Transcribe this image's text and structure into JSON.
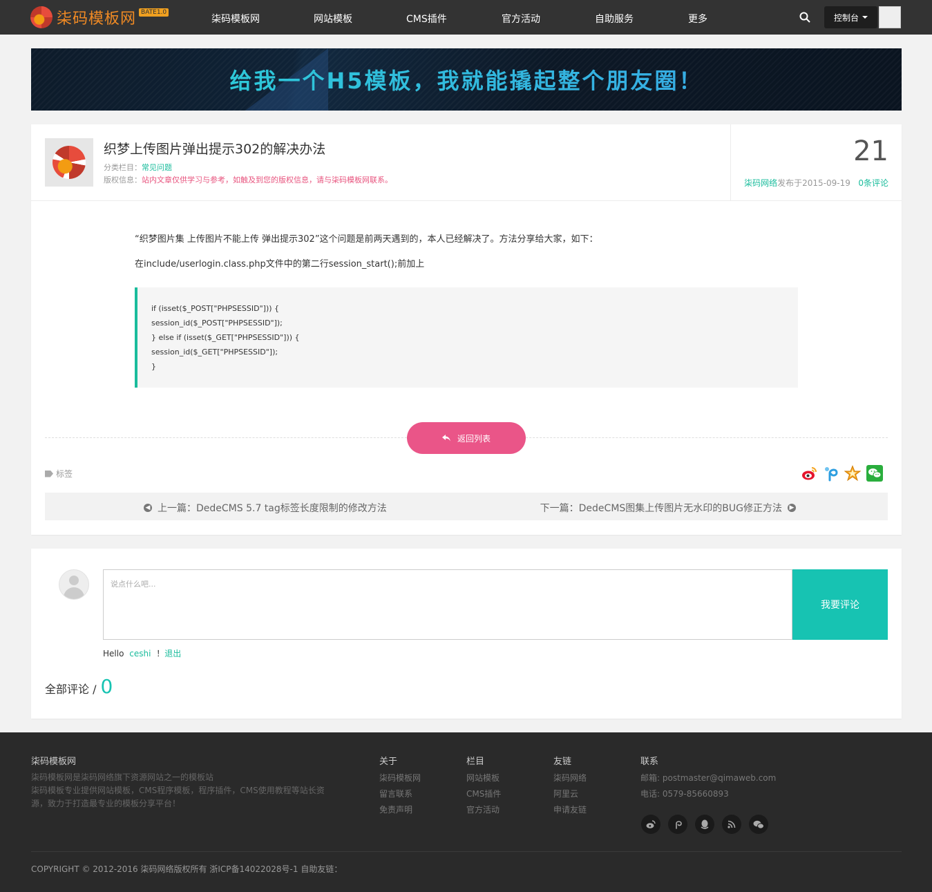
{
  "header": {
    "logo_text": "柒码模板网",
    "logo_badge": "BATE1.0",
    "nav": [
      "柒码模板网",
      "网站模板",
      "CMS插件",
      "官方活动",
      "自助服务",
      "更多"
    ],
    "console_label": "控制台"
  },
  "banner": {
    "text": "给我一个H5模板，我就能撬起整个朋友圈！"
  },
  "article": {
    "title": "织梦上传图片弹出提示302的解决办法",
    "category_label": "分类栏目：",
    "category": "常见问题",
    "copyright_label": "版权信息：",
    "copyright": "站内文章仅供学习与参考，如触及到您的版权信息，请与柒码模板网联系。",
    "day": "21",
    "author": "柒码网络",
    "published": "发布于2015-09-19",
    "comments_link": "0条评论",
    "p1": "“织梦图片集 上传图片不能上传 弹出提示302”这个问题是前两天遇到的，本人已经解决了。方法分享给大家，如下：",
    "p2": "在include/userlogin.class.php文件中的第二行session_start();前加上",
    "code": [
      "if (isset($_POST[\"PHPSESSID\"])) {",
      "session_id($_POST[\"PHPSESSID\"]);",
      "} else if (isset($_GET[\"PHPSESSID\"])) {",
      "session_id($_GET[\"PHPSESSID\"]);",
      "}"
    ],
    "back_label": "返回列表",
    "tags_label": "标签",
    "prev": "上一篇：DedeCMS 5.7 tag标签长度限制的修改方法",
    "next": "下一篇：DedeCMS图集上传图片无水印的BUG修正方法"
  },
  "comment": {
    "placeholder": "说点什么吧...",
    "submit_label": "我要评论",
    "hello_prefix": "Hello",
    "username": "ceshi",
    "logout_sep": "！",
    "logout": "退出",
    "all_label": "全部评论 /",
    "count": "0"
  },
  "footer": {
    "site_title": "柒码模板网",
    "site_desc1": "柒码模板网是柒码网络旗下资源网站之一的模板站",
    "site_desc2": "柒码模板专业提供网站模板，CMS程序模板，程序插件，CMS使用教程等站长资",
    "site_desc3": "源，致力于打造最专业的模板分享平台！",
    "col_about": {
      "title": "关于",
      "links": [
        "柒码模板网",
        "留言联系",
        "免责声明"
      ]
    },
    "col_column": {
      "title": "栏目",
      "links": [
        "网站模板",
        "CMS插件",
        "官方活动"
      ]
    },
    "col_friends": {
      "title": "友链",
      "links": [
        "柒码网络",
        "阿里云",
        "申请友链"
      ]
    },
    "col_contact": {
      "title": "联系",
      "email": "邮箱: postmaster@qimaweb.com",
      "phone": "电话: 0579-85660893"
    },
    "copyright": "COPYRIGHT © 2012-2016 柒码网络版权所有 浙ICP备14022028号-1 自助友链："
  },
  "colors": {
    "accent": "#1abc9c",
    "pink": "#ea5588",
    "submit": "#17c3b2"
  }
}
